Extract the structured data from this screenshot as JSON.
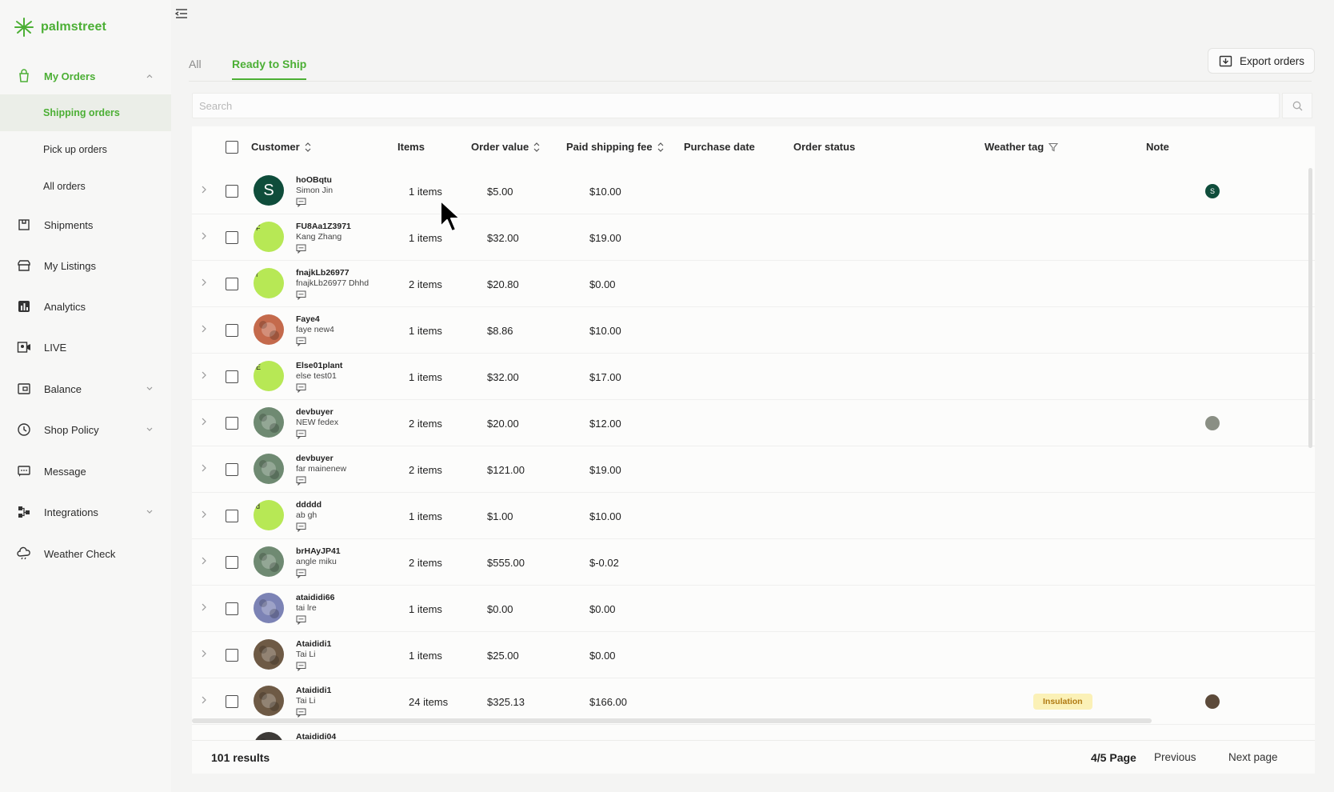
{
  "app": {
    "brand": "palmstreet",
    "brand_color": "#4caf35"
  },
  "sidebar": {
    "my_orders": "My Orders",
    "sub_items": [
      "Shipping orders",
      "Pick up orders",
      "All orders"
    ],
    "items": [
      {
        "label": "Shipments",
        "icon": "package-icon"
      },
      {
        "label": "My Listings",
        "icon": "storefront-icon"
      },
      {
        "label": "Analytics",
        "icon": "analytics-icon"
      },
      {
        "label": "LIVE",
        "icon": "live-icon"
      },
      {
        "label": "Balance",
        "icon": "wallet-icon"
      },
      {
        "label": "Shop Policy",
        "icon": "policy-icon"
      },
      {
        "label": "Message",
        "icon": "message-icon"
      },
      {
        "label": "Integrations",
        "icon": "integrations-icon"
      },
      {
        "label": "Weather Check",
        "icon": "cloud-icon"
      }
    ]
  },
  "tabs": [
    "All",
    "Ready to Ship"
  ],
  "active_tab": "Ready to Ship",
  "export_label": "Export orders",
  "search": {
    "placeholder": "Search",
    "value": ""
  },
  "columns": {
    "customer": "Customer",
    "items": "Items",
    "order_value": "Order value",
    "paid_shipping_fee": "Paid shipping fee",
    "purchase_date": "Purchase date",
    "order_status": "Order status",
    "weather_tag": "Weather tag",
    "note": "Note"
  },
  "rows": [
    {
      "id": "hoOBqtu",
      "name": "Simon Jin",
      "items": "1 items",
      "value": "$5.00",
      "fee": "$10.00",
      "avatar": "S",
      "avatar_color": "#0f4d3b",
      "note": "S",
      "tag": ""
    },
    {
      "id": "FU8Aa1Z3971",
      "name": "Kang Zhang",
      "items": "1 items",
      "value": "$32.00",
      "fee": "$19.00",
      "avatar": "F",
      "avatar_color": "#b7e855",
      "note": "",
      "tag": ""
    },
    {
      "id": "fnajkLb26977",
      "name": "fnajkLb26977 Dhhd",
      "items": "2 items",
      "value": "$20.80",
      "fee": "$0.00",
      "avatar": "f",
      "avatar_color": "#b7e855",
      "note": "",
      "tag": ""
    },
    {
      "id": "Faye4",
      "name": "faye new4",
      "items": "1 items",
      "value": "$8.86",
      "fee": "$10.00",
      "avatar": "",
      "avatar_color": "#c46a4c",
      "note": "",
      "tag": ""
    },
    {
      "id": "Else01plant",
      "name": "else test01",
      "items": "1 items",
      "value": "$32.00",
      "fee": "$17.00",
      "avatar": "E",
      "avatar_color": "#b7e855",
      "note": "",
      "tag": ""
    },
    {
      "id": "devbuyer",
      "name": "NEW fedex",
      "items": "2 items",
      "value": "$20.00",
      "fee": "$12.00",
      "avatar": "",
      "avatar_color": "#6f8a72",
      "note": "img",
      "tag": ""
    },
    {
      "id": "devbuyer",
      "name": "far mainenew",
      "items": "2 items",
      "value": "$121.00",
      "fee": "$19.00",
      "avatar": "",
      "avatar_color": "#6f8a72",
      "note": "",
      "tag": ""
    },
    {
      "id": "ddddd",
      "name": "ab gh",
      "items": "1 items",
      "value": "$1.00",
      "fee": "$10.00",
      "avatar": "d",
      "avatar_color": "#b7e855",
      "note": "",
      "tag": ""
    },
    {
      "id": "brHAyJP41",
      "name": "angle miku",
      "items": "2 items",
      "value": "$555.00",
      "fee": "$-0.02",
      "avatar": "",
      "avatar_color": "#6f8a72",
      "note": "",
      "tag": ""
    },
    {
      "id": "ataididi66",
      "name": "tai lre",
      "items": "1 items",
      "value": "$0.00",
      "fee": "$0.00",
      "avatar": "",
      "avatar_color": "#7c83b5",
      "note": "",
      "tag": ""
    },
    {
      "id": "Ataididi1",
      "name": "Tai Li",
      "items": "1 items",
      "value": "$25.00",
      "fee": "$0.00",
      "avatar": "",
      "avatar_color": "#6e5a45",
      "note": "",
      "tag": ""
    },
    {
      "id": "Ataididi1",
      "name": "Tai Li",
      "items": "24 items",
      "value": "$325.13",
      "fee": "$166.00",
      "avatar": "",
      "avatar_color": "#6e5a45",
      "note": "img2",
      "tag": "Insulation"
    },
    {
      "id": "Ataididi04",
      "name": "",
      "items": "",
      "value": "",
      "fee": "",
      "avatar": "",
      "avatar_color": "#3d3a37",
      "note": "",
      "tag": ""
    }
  ],
  "footer": {
    "results": "101 results",
    "page": "4/5 Page",
    "previous": "Previous",
    "next": "Next page"
  }
}
